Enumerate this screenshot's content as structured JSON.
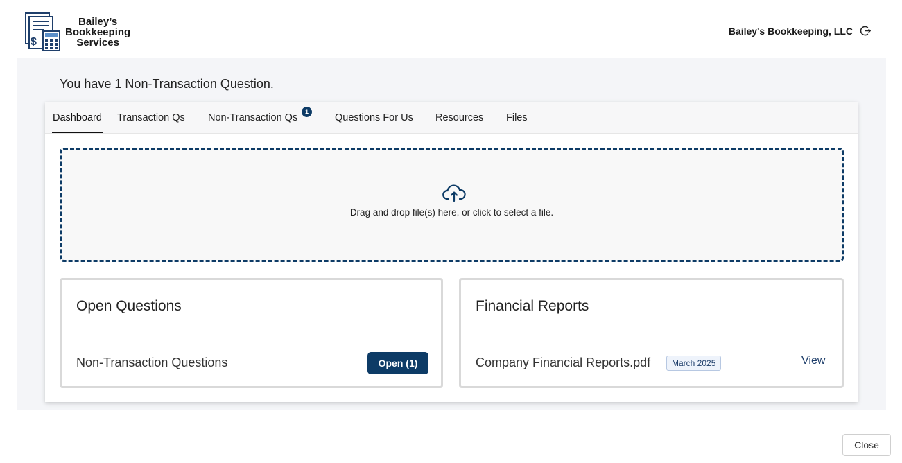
{
  "brand": {
    "logo_lines": [
      "Bailey’s",
      "Bookkeeping",
      "Services"
    ],
    "company_name": "Bailey's Bookkeeping, LLC"
  },
  "notice": {
    "prefix": "You have ",
    "link_text": "1 Non-Transaction Question."
  },
  "tabs": [
    {
      "label": "Dashboard",
      "active": true
    },
    {
      "label": "Transaction Qs",
      "active": false
    },
    {
      "label": "Non-Transaction Qs",
      "active": false,
      "badge": "1"
    },
    {
      "label": "Questions For Us",
      "active": false
    },
    {
      "label": "Resources",
      "active": false
    },
    {
      "label": "Files",
      "active": false
    }
  ],
  "dropzone": {
    "text": "Drag and drop file(s) here, or click to select a file."
  },
  "open_questions": {
    "title": "Open Questions",
    "row_label": "Non-Transaction Questions",
    "button_label": "Open (1)"
  },
  "financial_reports": {
    "title": "Financial Reports",
    "file_name": "Company Financial Reports.pdf",
    "date_badge": "March 2025",
    "view_label": "View"
  },
  "footer": {
    "close_label": "Close"
  },
  "colors": {
    "accent": "#0d3b66",
    "content_bg": "#f4f5f8"
  }
}
